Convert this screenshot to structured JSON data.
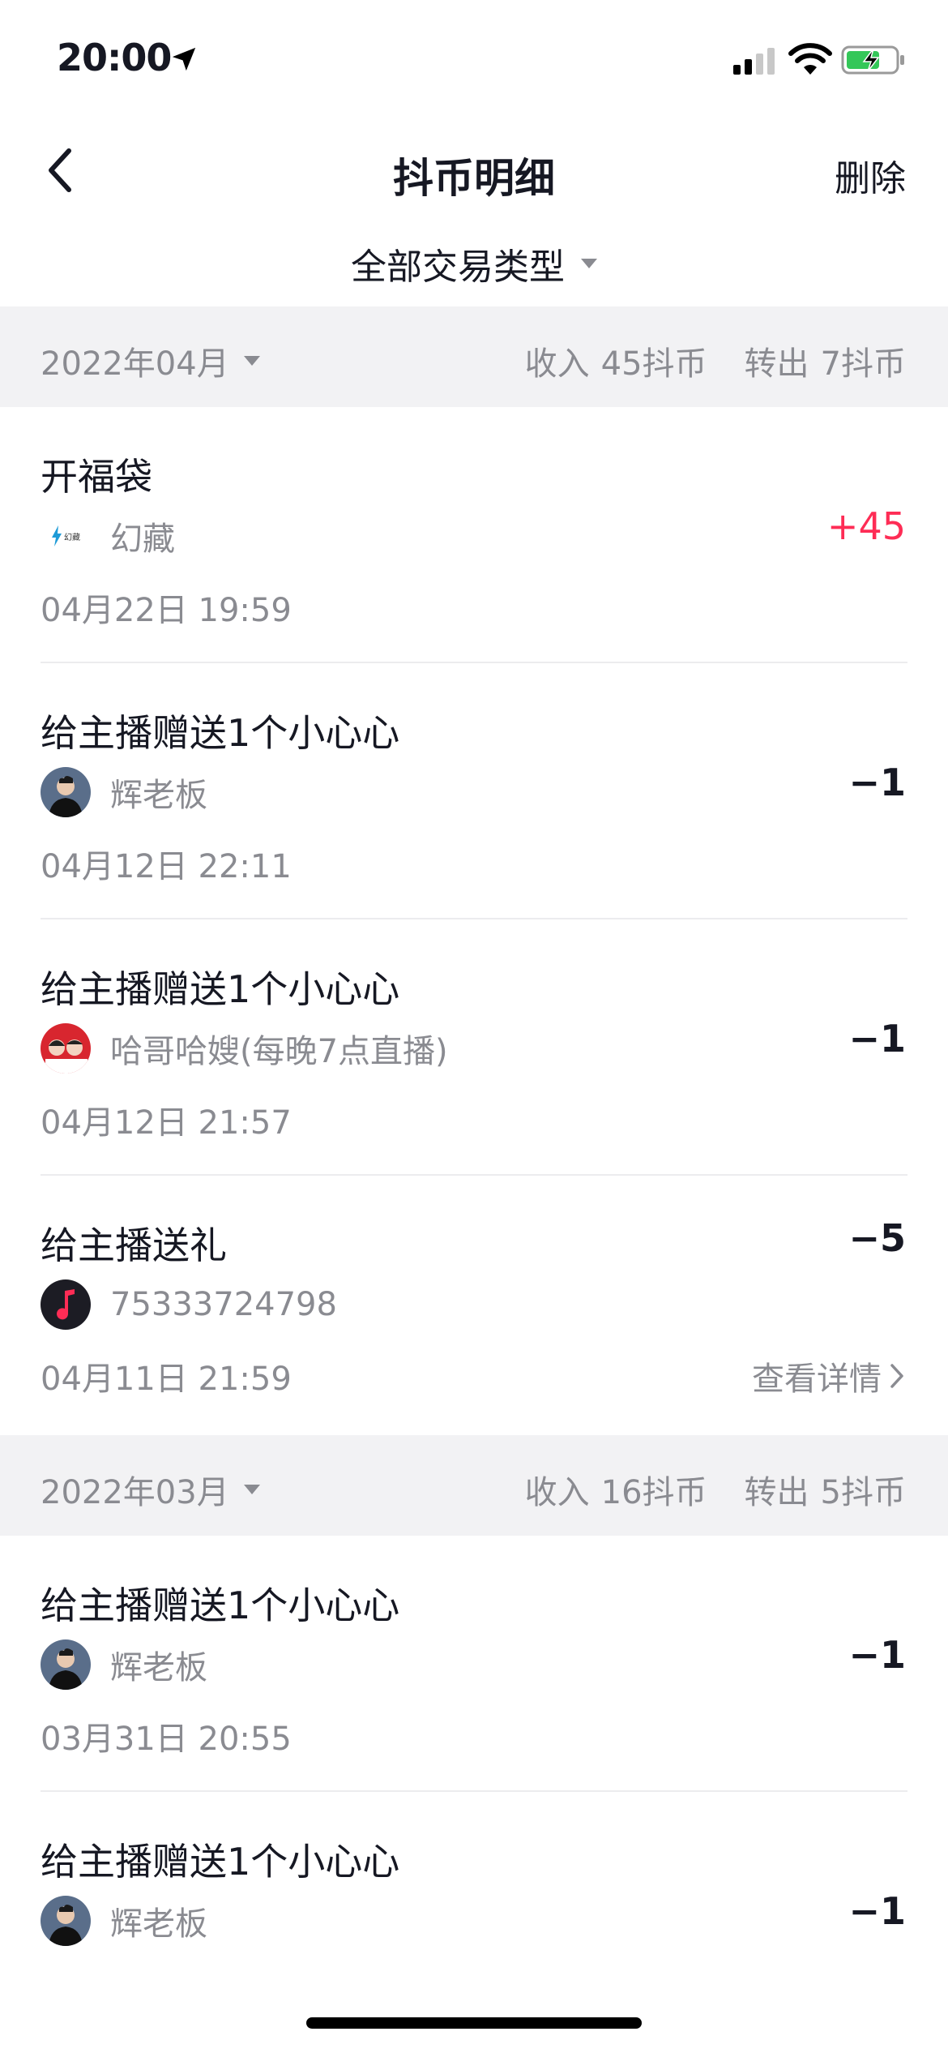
{
  "status_bar": {
    "time": "20:00"
  },
  "nav": {
    "title": "抖币明细",
    "delete_label": "删除"
  },
  "filter": {
    "label": "全部交易类型"
  },
  "months": [
    {
      "month": "2022年04月",
      "income_label": "收入",
      "income_value": "45抖币",
      "out_label": "转出",
      "out_value": "7抖币"
    },
    {
      "month": "2022年03月",
      "income_label": "收入",
      "income_value": "16抖币",
      "out_label": "转出",
      "out_value": "5抖币"
    }
  ],
  "transactions": [
    {
      "title": "开福袋",
      "user": "幻藏",
      "avatar_text": "幻藏",
      "time": "04月22日 19:59",
      "amount": "+45"
    },
    {
      "title": "给主播赠送1个小心心",
      "user": "辉老板",
      "time": "04月12日 22:11",
      "amount": "−1"
    },
    {
      "title": "给主播赠送1个小心心",
      "user": "哈哥哈嫂(每晚7点直播)",
      "time": "04月12日 21:57",
      "amount": "−1"
    },
    {
      "title": "给主播送礼",
      "user": "75333724798",
      "time": "04月11日 21:59",
      "amount": "−5",
      "detail_label": "查看详情"
    },
    {
      "title": "给主播赠送1个小心心",
      "user": "辉老板",
      "time": "03月31日 20:55",
      "amount": "−1"
    },
    {
      "title": "给主播赠送1个小心心",
      "user": "辉老板",
      "amount": "−1"
    }
  ],
  "colors": {
    "accent_positive": "#fe2c55",
    "secondary_text": "#8a8b91",
    "section_bg": "#f2f2f4"
  }
}
